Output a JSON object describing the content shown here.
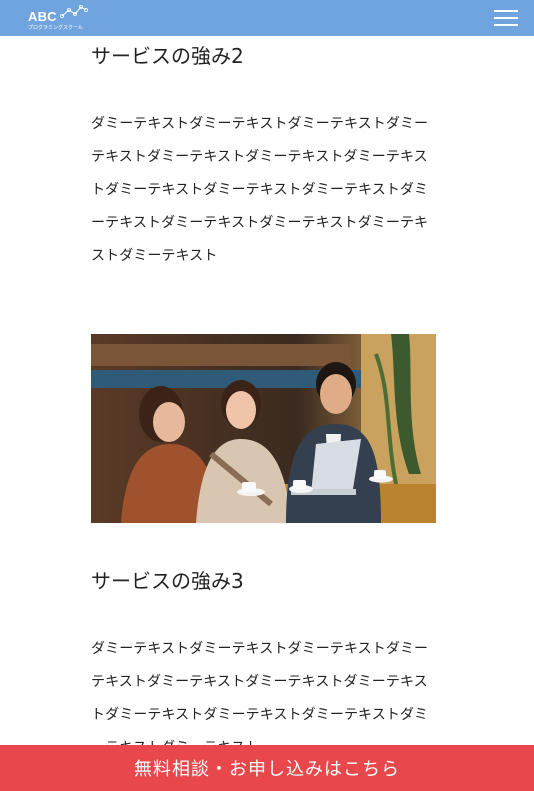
{
  "header": {
    "logo_text": "ABC",
    "logo_subtext": "プログラミングスクール",
    "menu_icon": "hamburger-menu-icon",
    "background_color": "#6fa4de"
  },
  "sections": [
    {
      "title": "サービスの強み2",
      "body": "ダミーテキストダミーテキストダミーテキストダミーテキストダミーテキストダミーテキストダミーテキストダミーテキストダミーテキストダミーテキストダミーテキストダミーテキストダミーテキストダミーテキストダミーテキスト"
    },
    {
      "title": "サービスの強み3",
      "body": "ダミーテキストダミーテキストダミーテキストダミーテキストダミーテキストダミーテキストダミーテキストダミーテキストダミーテキストダミーテキストダミーテキストダミーテキスト"
    }
  ],
  "cta": {
    "label": "無料相談・お申し込みはこちら",
    "color": "#e8474b"
  }
}
